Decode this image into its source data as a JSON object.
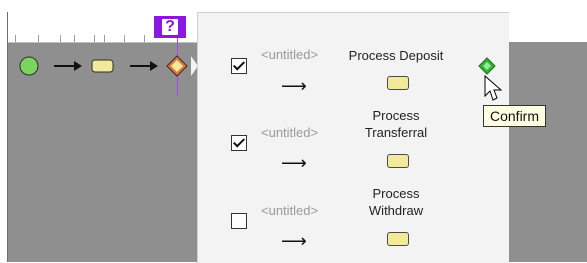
{
  "question_badge": "?",
  "rows": [
    {
      "checked": true,
      "placeholder": "<untitled>",
      "label_lines": [
        "Process Deposit"
      ]
    },
    {
      "checked": true,
      "placeholder": "<untitled>",
      "label_lines": [
        "Process",
        "Transferral"
      ]
    },
    {
      "checked": false,
      "placeholder": "<untitled>",
      "label_lines": [
        "Process",
        "Withdraw"
      ]
    }
  ],
  "tooltip": {
    "text": "Confirm"
  },
  "icons": {
    "start": "start-event-icon",
    "task": "task-icon",
    "gateway": "gateway-icon",
    "confirm": "confirm-icon",
    "cursor": "mouse-cursor-icon"
  },
  "colors": {
    "accent": "#8a18e0",
    "start_event": "#7cd45d",
    "task_fill": "#f1ea9a",
    "gateway": "#e7743b",
    "confirm": "#2fb82f",
    "tooltip_bg": "#ffffe1"
  }
}
